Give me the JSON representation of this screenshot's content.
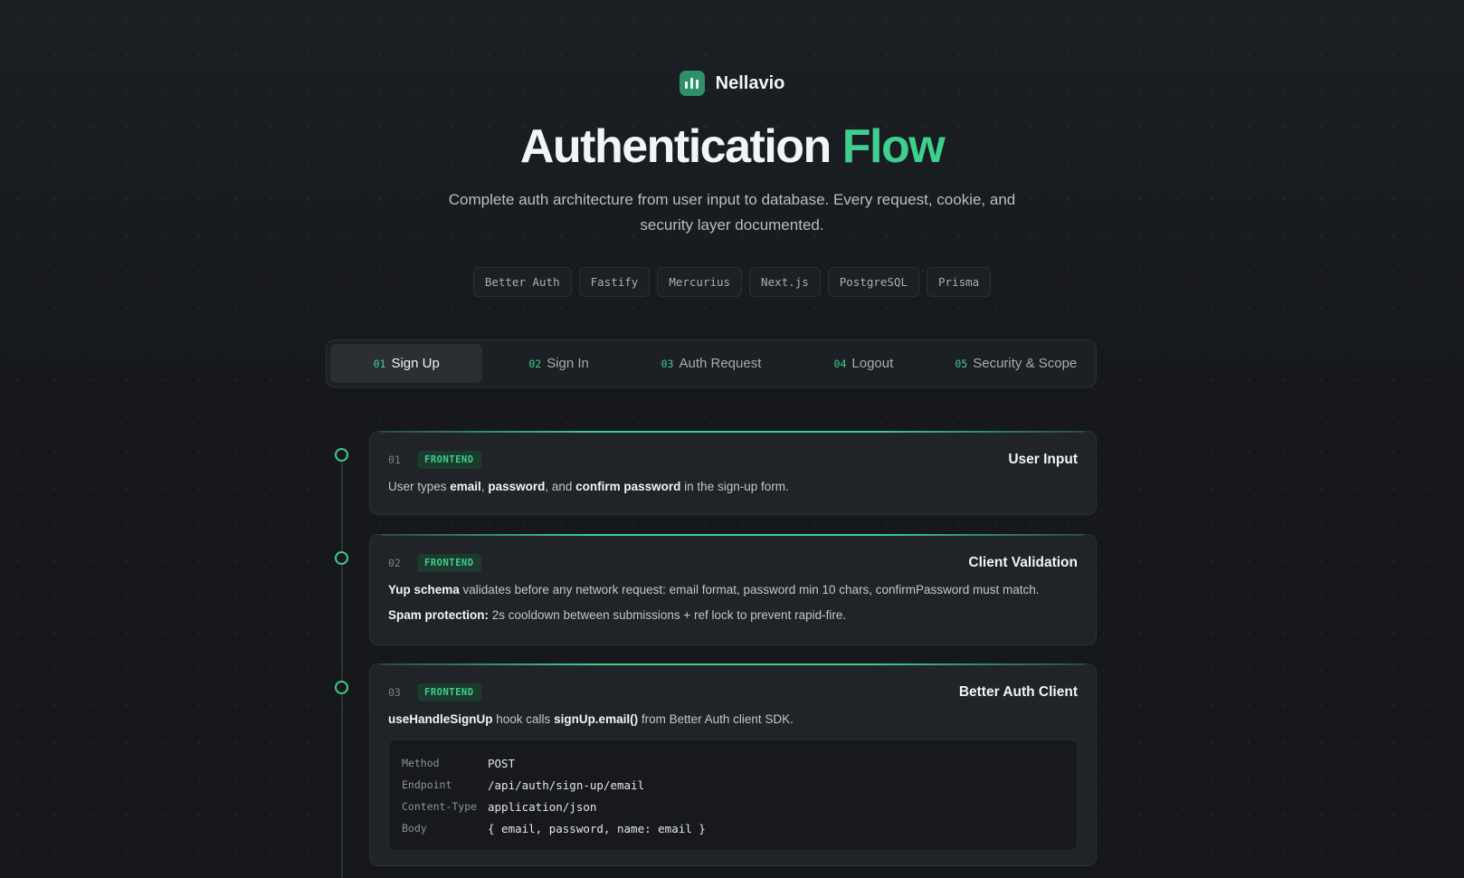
{
  "brand": {
    "name": "Nellavio"
  },
  "hero": {
    "title_main": "Authentication",
    "title_accent": "Flow",
    "subtitle": "Complete auth architecture from user input to database. Every request, cookie, and security layer documented."
  },
  "tech_tags": [
    "Better Auth",
    "Fastify",
    "Mercurius",
    "Next.js",
    "PostgreSQL",
    "Prisma"
  ],
  "tabs": [
    {
      "num": "01",
      "label": "Sign Up",
      "active": true
    },
    {
      "num": "02",
      "label": "Sign In"
    },
    {
      "num": "03",
      "label": "Auth Request"
    },
    {
      "num": "04",
      "label": "Logout"
    },
    {
      "num": "05",
      "label": "Security & Scope"
    }
  ],
  "colors": {
    "accent": "#3ecf8e",
    "background": "#16181c",
    "card": "#202327"
  },
  "steps": [
    {
      "num": "01",
      "badge": "FRONTEND",
      "title": "User Input",
      "text": {
        "p1": "User types ",
        "b1": "email",
        "p2": ", ",
        "b2": "password",
        "p3": ", and ",
        "b3": "confirm password",
        "p4": " in the sign-up form."
      }
    },
    {
      "num": "02",
      "badge": "FRONTEND",
      "title": "Client Validation",
      "line1": {
        "b1": "Yup schema",
        "p1": " validates before any network request: email format, password min 10 chars, confirmPassword must match."
      },
      "line2": {
        "b1": "Spam protection:",
        "p1": " 2s cooldown between submissions + ref lock to prevent rapid-fire."
      }
    },
    {
      "num": "03",
      "badge": "FRONTEND",
      "title": "Better Auth Client",
      "text": {
        "b1": "useHandleSignUp",
        "p1": " hook calls ",
        "b2": "signUp.email()",
        "p2": " from Better Auth client SDK."
      },
      "request": [
        {
          "key": "Method",
          "value": "POST"
        },
        {
          "key": "Endpoint",
          "value": "/api/auth/sign-up/email"
        },
        {
          "key": "Content-Type",
          "value": "application/json"
        },
        {
          "key": "Body",
          "value": "{ email, password, name: email }"
        }
      ]
    }
  ]
}
